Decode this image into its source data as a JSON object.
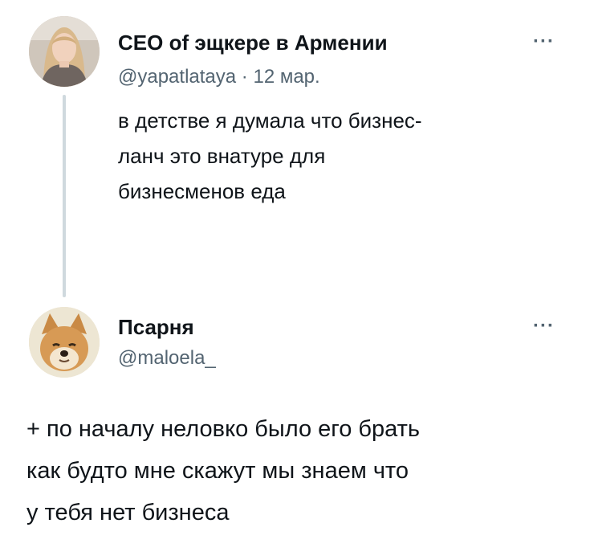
{
  "tweets": [
    {
      "display_name": "CEO of эщкере в Армении",
      "handle": "@yapatlataya",
      "separator": "·",
      "date": "12 мар.",
      "text_lines": [
        "в детстве я думала что бизнес-",
        "ланч это внатуре для",
        "бизнесменов еда"
      ],
      "more_label": "···",
      "avatar_icon": "person-photo-avatar"
    },
    {
      "display_name": "Псарня",
      "handle": "@maloela_",
      "more_label": "···",
      "avatar_icon": "shiba-dog-avatar",
      "text_lines": [
        "+ по началу неловко было его брать",
        "как будто мне скажут мы знаем что",
        "у тебя нет бизнеса"
      ]
    }
  ],
  "colors": {
    "text": "#0f1419",
    "secondary": "#536471",
    "thread_line": "#cfd9de"
  }
}
